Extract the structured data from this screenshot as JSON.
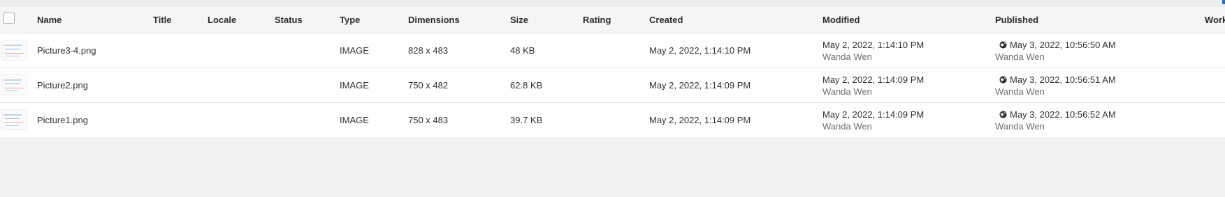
{
  "header": {
    "columns": {
      "name": "Name",
      "title": "Title",
      "locale": "Locale",
      "status": "Status",
      "type": "Type",
      "dimensions": "Dimensions",
      "size": "Size",
      "rating": "Rating",
      "created": "Created",
      "modified": "Modified",
      "published": "Published",
      "workflow": "Work"
    }
  },
  "rows": [
    {
      "name": "Picture3-4.png",
      "type": "IMAGE",
      "dimensions": "828 x 483",
      "size": "48 KB",
      "created": "May 2, 2022, 1:14:10 PM",
      "modified_date": "May 2, 2022, 1:14:10 PM",
      "modified_by": "Wanda Wen",
      "published_date": "May 3, 2022, 10:56:50 AM",
      "published_by": "Wanda Wen"
    },
    {
      "name": "Picture2.png",
      "type": "IMAGE",
      "dimensions": "750 x 482",
      "size": "62.8 KB",
      "created": "May 2, 2022, 1:14:09 PM",
      "modified_date": "May 2, 2022, 1:14:09 PM",
      "modified_by": "Wanda Wen",
      "published_date": "May 3, 2022, 10:56:51 AM",
      "published_by": "Wanda Wen"
    },
    {
      "name": "Picture1.png",
      "type": "IMAGE",
      "dimensions": "750 x 483",
      "size": "39.7 KB",
      "created": "May 2, 2022, 1:14:09 PM",
      "modified_date": "May 2, 2022, 1:14:09 PM",
      "modified_by": "Wanda Wen",
      "published_date": "May 3, 2022, 10:56:52 AM",
      "published_by": "Wanda Wen"
    }
  ],
  "icons": {
    "published": "globe-icon",
    "thumbnail": "image-thumbnail"
  },
  "colors": {
    "accent": "#1473e6",
    "background": "#f2f2f2",
    "row_background": "#ffffff"
  }
}
